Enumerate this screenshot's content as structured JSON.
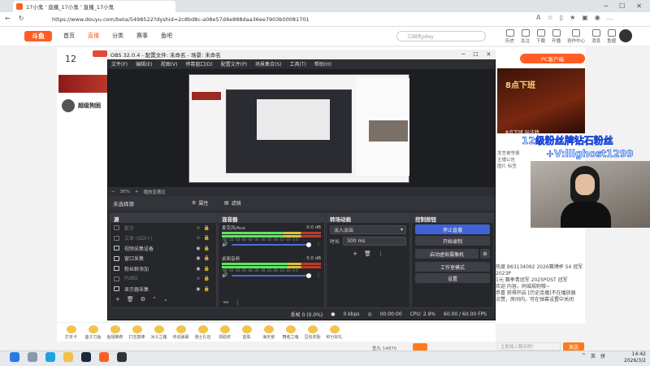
{
  "browser": {
    "tab_title": "17小鬼 ' 直播_17小鬼 ' 直播_17小鬼",
    "url": "https://www.douyu.com/beta/5498522?dyshid=2c8bd8c-a08e57d4e888daa36ee7903b00081701"
  },
  "douyu": {
    "logo": "斗鱼",
    "nav": [
      "首页",
      "直播",
      "分类",
      "赛事",
      "鱼吧"
    ],
    "search_placeholder": "三国杀pdey",
    "header_icons": [
      "历史",
      "关注",
      "下载",
      "开播",
      "创作中心",
      "消息",
      "鱼翅"
    ],
    "room_number": "12",
    "room_sub": "​",
    "anchor_name": "超级狗困",
    "pc_app": "PC客户端",
    "ad_title": "8点下班",
    "ad_sub": "8点下班 玩法特",
    "right_lines": [
      "发言被举报",
      "主播公告",
      "图片 标签"
    ],
    "overlay_line1": "12级粉丝牌钻石粉丝",
    "overlay_line2": "+V:lllghost1299",
    "chat_lines": [
      "热度 B63134092 2026赛博杯 S4 冠军 2023P",
      "1元 赛季青冠军 2025POST 冠军",
      "欢迎 内容，同城规则哦~",
      "恭喜 获得开启 [历史连播]不在播放器",
      "点赞，房间内，可在弹幕设置中关闭"
    ],
    "chat_placeholder": "立即加入聊天吧！",
    "send_label": "发送",
    "gifts": [
      "打年卡",
      "萤子刀鱼",
      "鱼翅推荐",
      "打击鼓棒",
      "冰斗之路",
      "传说弹幕",
      "骑士礼包",
      "领助奖",
      "蓝珠",
      "海天使",
      "舞者之魂",
      "豆包奖励",
      "积分好礼"
    ],
    "fish_balance": "鱼丸 14870"
  },
  "obs": {
    "title": "OBS 32.0.4 - 配置文件: 未命名 - 场景: 未命名",
    "menu": [
      "文件(F)",
      "编辑(E)",
      "视图(V)",
      "停靠窗口(D)",
      "配置文件(P)",
      "场景集合(S)",
      "工具(T)",
      "帮助(H)"
    ],
    "zoom": "30%",
    "zoom_label": "播放显著区",
    "selected_none": "未选择源",
    "props_label": "属性",
    "filters_label": "滤镜",
    "docks": {
      "sources": "源",
      "mixer": "混音器",
      "transitions": "转场动画",
      "controls": "控制按钮"
    },
    "sources": [
      {
        "name": "数字",
        "visible": false
      },
      {
        "name": "文本 (GDI+)",
        "visible": false
      },
      {
        "name": "视频采集设备",
        "visible": true
      },
      {
        "name": "窗口采集",
        "visible": true
      },
      {
        "name": "粉丝群添加",
        "visible": true
      },
      {
        "name": "PUBG",
        "visible": false
      },
      {
        "name": "显示器采集",
        "visible": true
      }
    ],
    "mixer": [
      {
        "name": "麦克风/Aux",
        "db": "0.0 dB",
        "level": 0.62
      },
      {
        "name": "桌面音频",
        "db": "0.0 dB",
        "level": 0.66
      }
    ],
    "mixer_ticks": "-60 -55 -50 -45 -40 -35 -30 -25 -20 -15 -10 -5 0",
    "transition": "淡入淡出",
    "duration_label": "时长",
    "duration": "300 ms",
    "controls": [
      "停止直播",
      "开始录制",
      "启动虚拟摄像机",
      "工作室模式",
      "设置"
    ],
    "status": {
      "dropped": "丢帧 0 (0.0%)",
      "kbps": "0 kbps",
      "time": "00:00:00",
      "cpu": "CPU: 2.9%",
      "fps": "60.00 / 60.00 FPS"
    }
  },
  "taskbar": {
    "tray": [
      "英",
      "拼"
    ],
    "time": "14:42",
    "date": "2026/3/2"
  }
}
